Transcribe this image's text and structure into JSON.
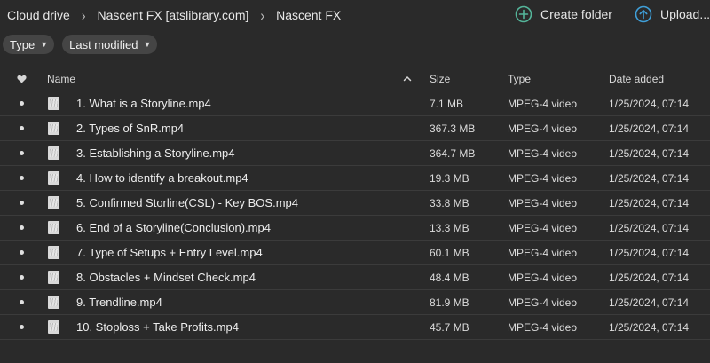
{
  "breadcrumb": [
    "Cloud drive",
    "Nascent FX [atslibrary.com]",
    "Nascent FX"
  ],
  "actions": {
    "create_folder": "Create folder",
    "upload": "Upload..."
  },
  "filters": {
    "type": "Type",
    "last_modified": "Last modified"
  },
  "columns": {
    "name": "Name",
    "size": "Size",
    "type": "Type",
    "date_added": "Date added"
  },
  "colors": {
    "create_icon": "#54b59a",
    "upload_icon": "#3f9fd8",
    "background": "#2a2a2a"
  },
  "files": [
    {
      "name": "1. What is a Storyline.mp4",
      "size": "7.1 MB",
      "type": "MPEG-4 video",
      "date": "1/25/2024, 07:14"
    },
    {
      "name": "2. Types of SnR.mp4",
      "size": "367.3 MB",
      "type": "MPEG-4 video",
      "date": "1/25/2024, 07:14"
    },
    {
      "name": "3. Establishing a Storyline.mp4",
      "size": "364.7 MB",
      "type": "MPEG-4 video",
      "date": "1/25/2024, 07:14"
    },
    {
      "name": "4. How to identify a breakout.mp4",
      "size": "19.3 MB",
      "type": "MPEG-4 video",
      "date": "1/25/2024, 07:14"
    },
    {
      "name": "5. Confirmed Storline(CSL) - Key BOS.mp4",
      "size": "33.8 MB",
      "type": "MPEG-4 video",
      "date": "1/25/2024, 07:14"
    },
    {
      "name": "6. End of a Storyline(Conclusion).mp4",
      "size": "13.3 MB",
      "type": "MPEG-4 video",
      "date": "1/25/2024, 07:14"
    },
    {
      "name": "7. Type of Setups + Entry Level.mp4",
      "size": "60.1 MB",
      "type": "MPEG-4 video",
      "date": "1/25/2024, 07:14"
    },
    {
      "name": "8. Obstacles + Mindset Check.mp4",
      "size": "48.4 MB",
      "type": "MPEG-4 video",
      "date": "1/25/2024, 07:14"
    },
    {
      "name": "9. Trendline.mp4",
      "size": "81.9 MB",
      "type": "MPEG-4 video",
      "date": "1/25/2024, 07:14"
    },
    {
      "name": "10. Stoploss + Take Profits.mp4",
      "size": "45.7 MB",
      "type": "MPEG-4 video",
      "date": "1/25/2024, 07:14"
    }
  ]
}
